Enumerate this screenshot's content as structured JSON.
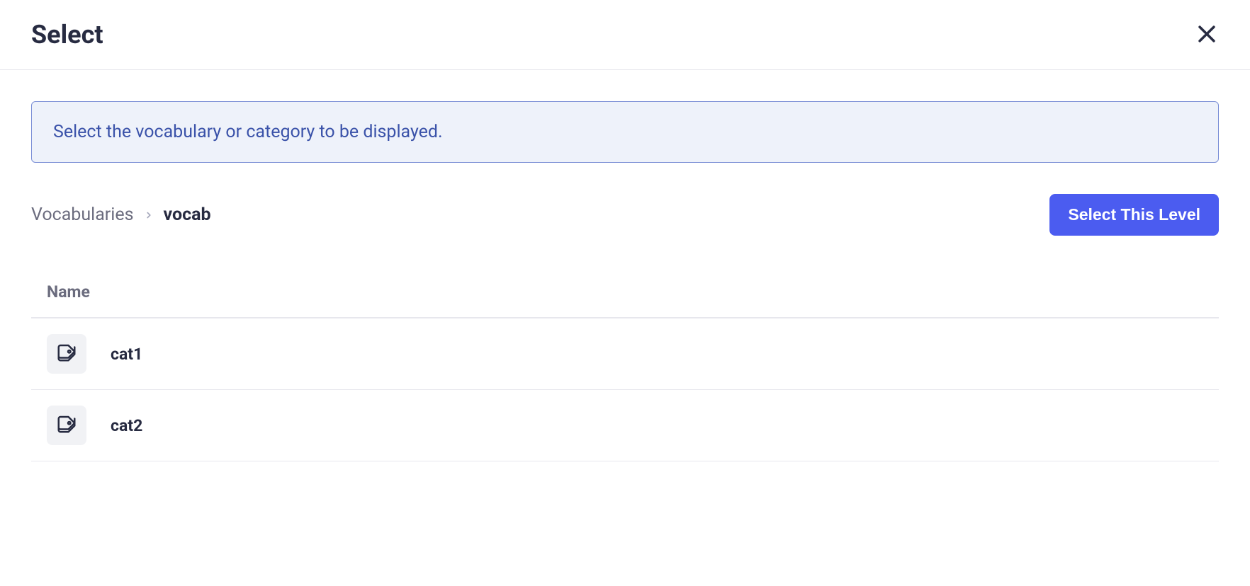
{
  "header": {
    "title": "Select"
  },
  "info": {
    "message": "Select the vocabulary or category to be displayed."
  },
  "breadcrumb": {
    "root": "Vocabularies",
    "current": "vocab"
  },
  "actions": {
    "select_level": "Select This Level"
  },
  "table": {
    "header_name": "Name",
    "rows": [
      {
        "name": "cat1"
      },
      {
        "name": "cat2"
      }
    ]
  }
}
